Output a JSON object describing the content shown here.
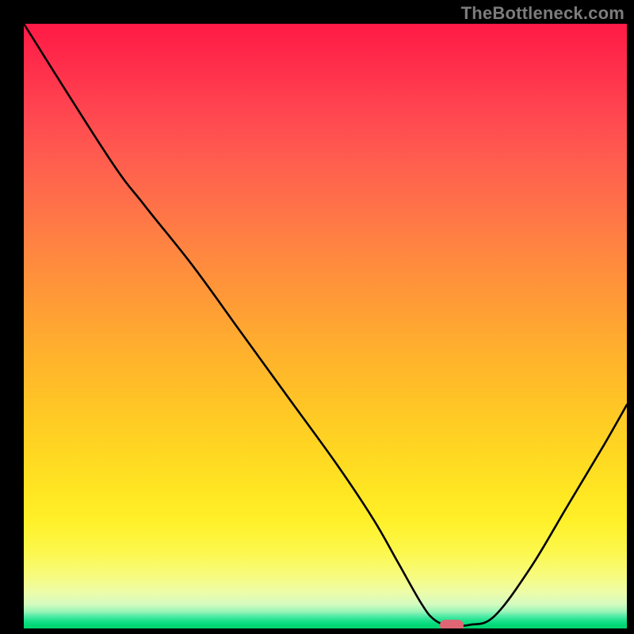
{
  "watermark": "TheBottleneck.com",
  "chart_data": {
    "type": "line",
    "title": "",
    "xlabel": "",
    "ylabel": "",
    "xlim": [
      0,
      100
    ],
    "ylim": [
      0,
      100
    ],
    "grid": false,
    "series": [
      {
        "name": "bottleneck-curve",
        "x": [
          0,
          14,
          20,
          28,
          36,
          44,
          52,
          58,
          62,
          66,
          68,
          70,
          72,
          74,
          78,
          84,
          90,
          96,
          100
        ],
        "values": [
          100,
          78,
          70,
          60,
          49,
          38,
          27,
          18,
          11,
          4,
          1.5,
          0.6,
          0.5,
          0.6,
          2,
          10,
          20,
          30,
          37
        ]
      }
    ],
    "marker": {
      "x": 71,
      "y": 0.5,
      "label": ""
    },
    "legend": false
  },
  "colors": {
    "curve": "#000000",
    "marker": "#e06675",
    "frame": "#000000"
  }
}
